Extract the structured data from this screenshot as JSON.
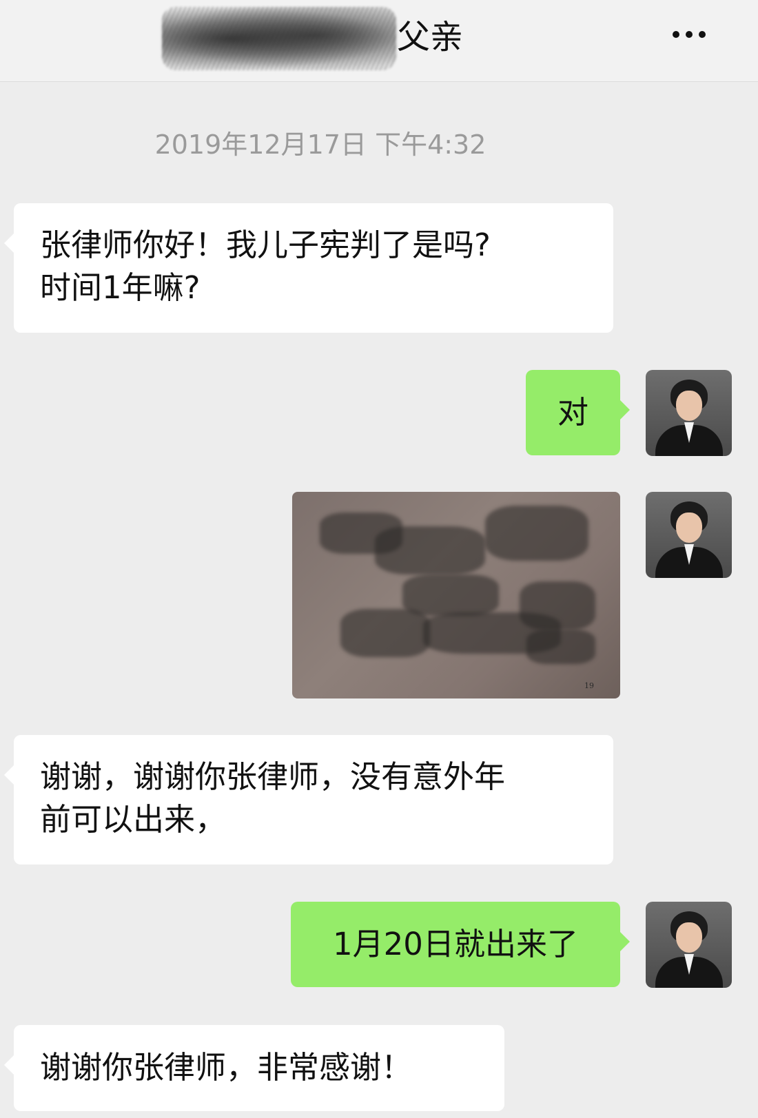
{
  "header": {
    "contact_name": "父亲",
    "more_icon": "more-dots-icon"
  },
  "timestamp": "2019年12月17日 下午4:32",
  "messages": [
    {
      "side": "left",
      "text_lines": [
        "张律师你好！我儿子宪判了是吗?",
        "时间1年嘛?"
      ]
    },
    {
      "side": "right",
      "text": "对"
    },
    {
      "side": "right",
      "type": "image",
      "caption": "19"
    },
    {
      "side": "left",
      "text_lines": [
        "谢谢，谢谢你张律师，没有意外年",
        "前可以出来，"
      ]
    },
    {
      "side": "right",
      "text": "1月20日就出来了"
    },
    {
      "side": "left",
      "text_lines": [
        "谢谢你张律师，非常感谢！"
      ]
    }
  ],
  "colors": {
    "background": "#ededed",
    "incoming_bubble": "#ffffff",
    "outgoing_bubble": "#95ec69"
  }
}
